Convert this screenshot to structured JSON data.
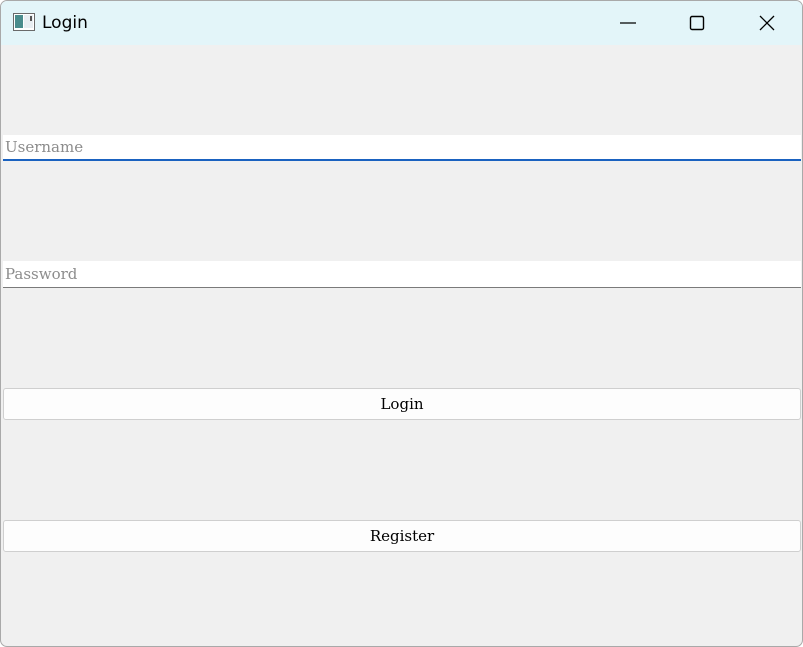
{
  "window": {
    "title": "Login",
    "icon": "app-window-icon",
    "controls": [
      "minimize-icon",
      "maximize-icon",
      "close-icon"
    ]
  },
  "form": {
    "username": {
      "value": "",
      "placeholder": "Username"
    },
    "password": {
      "value": "",
      "placeholder": "Password"
    },
    "login_label": "Login",
    "register_label": "Register"
  },
  "colors": {
    "titlebar": "#e3f5f9",
    "window_bg": "#f0f0f0",
    "focus_accent": "#1a62c0"
  }
}
